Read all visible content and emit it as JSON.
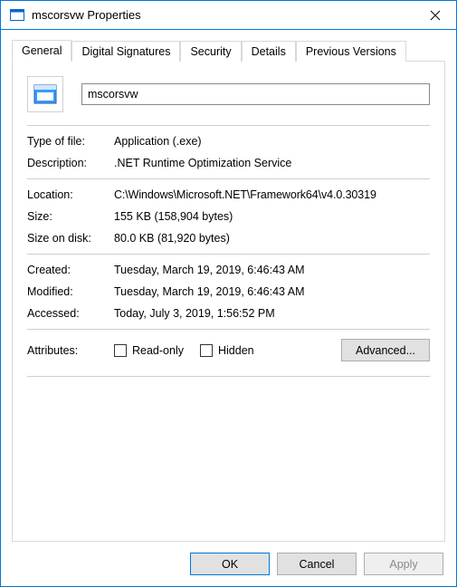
{
  "window": {
    "title": "mscorsvw Properties"
  },
  "tabs": {
    "general": "General",
    "digital_signatures": "Digital Signatures",
    "security": "Security",
    "details": "Details",
    "previous_versions": "Previous Versions"
  },
  "general": {
    "name_value": "mscorsvw",
    "labels": {
      "type_of_file": "Type of file:",
      "description": "Description:",
      "location": "Location:",
      "size": "Size:",
      "size_on_disk": "Size on disk:",
      "created": "Created:",
      "modified": "Modified:",
      "accessed": "Accessed:",
      "attributes": "Attributes:"
    },
    "values": {
      "type_of_file": "Application (.exe)",
      "description": ".NET Runtime Optimization Service",
      "location": "C:\\Windows\\Microsoft.NET\\Framework64\\v4.0.30319",
      "size": "155 KB (158,904 bytes)",
      "size_on_disk": "80.0 KB (81,920 bytes)",
      "created": "Tuesday, March 19, 2019, 6:46:43 AM",
      "modified": "Tuesday, March 19, 2019, 6:46:43 AM",
      "accessed": "Today, July 3, 2019, 1:56:52 PM"
    },
    "attributes": {
      "read_only": "Read-only",
      "hidden": "Hidden",
      "advanced": "Advanced..."
    }
  },
  "buttons": {
    "ok": "OK",
    "cancel": "Cancel",
    "apply": "Apply"
  }
}
